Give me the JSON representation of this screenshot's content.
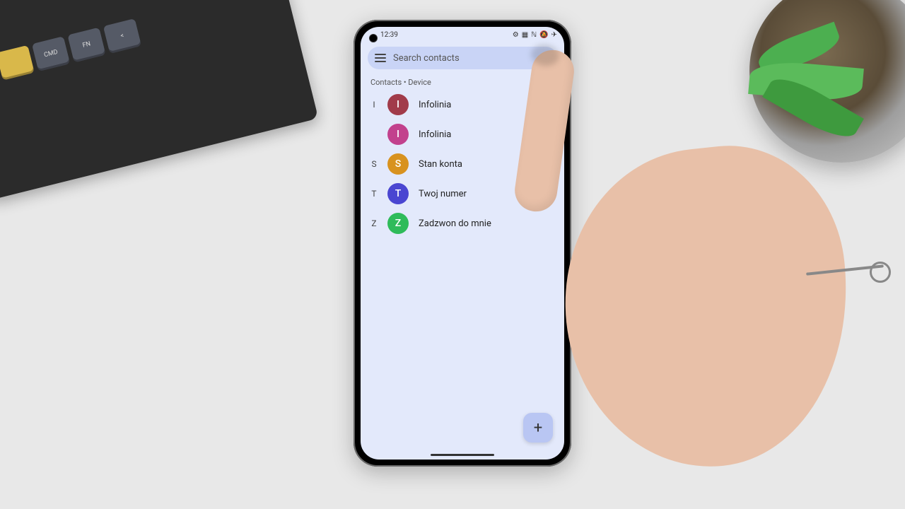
{
  "statusbar": {
    "time": "12:39"
  },
  "search": {
    "placeholder": "Search contacts"
  },
  "section": {
    "label": "Contacts • Device"
  },
  "contacts": [
    {
      "index": "I",
      "initial": "I",
      "name": "Infolinia",
      "color": "#a13b4a"
    },
    {
      "index": "",
      "initial": "I",
      "name": "Infolinia",
      "color": "#c2418d"
    },
    {
      "index": "S",
      "initial": "S",
      "name": "Stan konta",
      "color": "#d8921f"
    },
    {
      "index": "T",
      "initial": "T",
      "name": "Twoj numer",
      "color": "#4a46d1"
    },
    {
      "index": "Z",
      "initial": "Z",
      "name": "Zadzwon do mnie",
      "color": "#2fbb5a"
    }
  ],
  "fab": {
    "symbol": "+"
  },
  "keyboard": {
    "keys": [
      "CMD",
      "FN",
      "<"
    ]
  }
}
